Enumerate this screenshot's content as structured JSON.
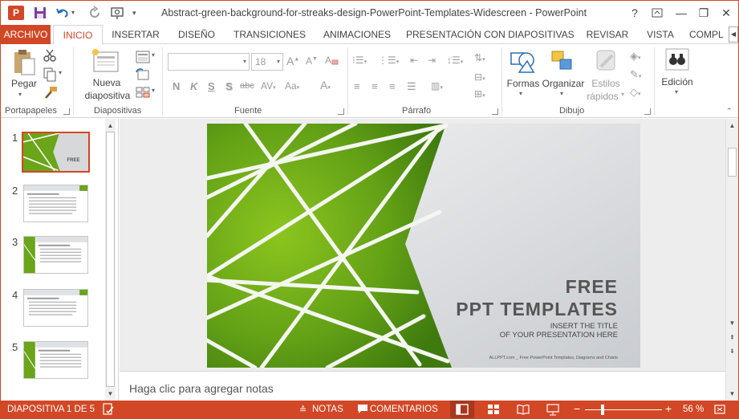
{
  "window": {
    "title": "Abstract-green-background-for-streaks-design-PowerPoint-Templates-Widescreen - PowerPoint",
    "app_letter": "P",
    "help": "?",
    "minimize": "—",
    "restore": "❐",
    "close": "✕"
  },
  "tabs": [
    {
      "label": "ARCHIVO"
    },
    {
      "label": "INICIO"
    },
    {
      "label": "INSERTAR"
    },
    {
      "label": "DISEÑO"
    },
    {
      "label": "TRANSICIONES"
    },
    {
      "label": "ANIMACIONES"
    },
    {
      "label": "PRESENTACIÓN CON DIAPOSITIVAS"
    },
    {
      "label": "REVISAR"
    },
    {
      "label": "VISTA"
    },
    {
      "label": "COMPL"
    }
  ],
  "ribbon": {
    "clipboard": {
      "paste": "Pegar",
      "group": "Portapapeles"
    },
    "slides": {
      "new_slide_1": "Nueva",
      "new_slide_2": "diapositiva",
      "group": "Diapositivas"
    },
    "font": {
      "font_name": "",
      "font_size": "18",
      "bold": "N",
      "italic": "K",
      "underline": "S",
      "shadow": "S",
      "strike": "abc",
      "group": "Fuente"
    },
    "paragraph": {
      "group": "Párrafo"
    },
    "drawing": {
      "shapes": "Formas",
      "arrange": "Organizar",
      "styles_1": "Estilos",
      "styles_2": "rápidos",
      "group": "Dibujo"
    },
    "editing": {
      "label": "Edición"
    }
  },
  "thumbnails": [
    {
      "num": "1"
    },
    {
      "num": "2"
    },
    {
      "num": "3"
    },
    {
      "num": "4"
    },
    {
      "num": "5"
    }
  ],
  "slide": {
    "title_1": "FREE",
    "title_2": "PPT TEMPLATES",
    "subtitle_1": "INSERT THE TITLE",
    "subtitle_2": "OF YOUR PRESENTATION HERE",
    "footer": "ALLPPT.com _ Free PowerPoint Templates, Diagrams and Charts"
  },
  "notes": {
    "placeholder": "Haga clic para agregar notas"
  },
  "status": {
    "slide_info": "DIAPOSITIVA 1 DE 5",
    "notes": "NOTAS",
    "comments": "COMENTARIOS",
    "zoom_minus": "−",
    "zoom_plus": "+",
    "zoom": "56 %"
  },
  "colors": {
    "accent": "#d24726",
    "slide_green": "#6aa51a"
  }
}
